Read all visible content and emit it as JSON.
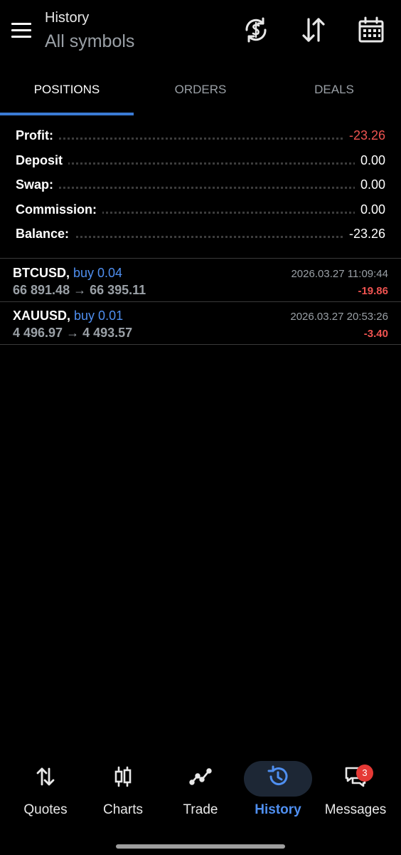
{
  "header": {
    "title": "History",
    "subtitle": "All symbols",
    "icons": [
      "currency-sync-icon",
      "sort-icon",
      "calendar-icon"
    ]
  },
  "tabs": [
    {
      "label": "POSITIONS",
      "active": true
    },
    {
      "label": "ORDERS",
      "active": false
    },
    {
      "label": "DEALS",
      "active": false
    }
  ],
  "summary": [
    {
      "label": "Profit:",
      "value": "-23.26"
    },
    {
      "label": "Deposit",
      "value": "0.00"
    },
    {
      "label": "Swap:",
      "value": "0.00"
    },
    {
      "label": "Commission:",
      "value": "0.00"
    },
    {
      "label": "Balance:",
      "value": "-23.26"
    }
  ],
  "positions": [
    {
      "symbol": "BTCUSD,",
      "side": "buy 0.04",
      "prices": "66 891.48 → 66 395.11",
      "time": "2026.03.27 11:09:44",
      "profit": "-19.86"
    },
    {
      "symbol": "XAUUSD,",
      "side": "buy 0.01",
      "prices": "4 496.97 → 4 493.57",
      "time": "2026.03.27 20:53:26",
      "profit": "-3.40"
    }
  ],
  "nav": [
    {
      "label": "Quotes",
      "icon": "quotes-arrows-icon"
    },
    {
      "label": "Charts",
      "icon": "candlestick-icon"
    },
    {
      "label": "Trade",
      "icon": "trade-line-icon"
    },
    {
      "label": "History",
      "icon": "history-icon",
      "active": true
    },
    {
      "label": "Messages",
      "icon": "messages-icon"
    }
  ],
  "messages_badge": "3",
  "colors": {
    "accent": "#4f8ff0",
    "negative": "#ef5350",
    "background": "#000000",
    "muted": "#9aa0a6"
  }
}
